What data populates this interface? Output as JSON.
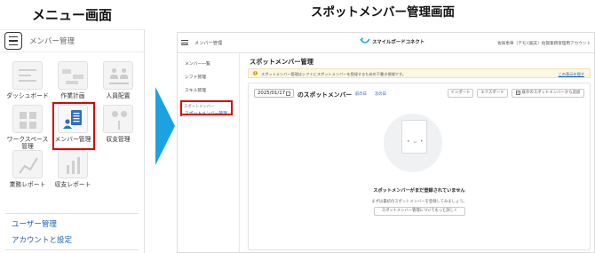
{
  "captions": {
    "left": "メニュー画面",
    "right": "スポットメンバー管理画面"
  },
  "menu": {
    "header_title": "メンバー管理",
    "tiles": [
      {
        "label": "ダッシュボード",
        "icon": "dashboard-icon"
      },
      {
        "label": "作業計画",
        "icon": "work-plan-icon"
      },
      {
        "label": "人員配置",
        "icon": "staff-placement-icon"
      },
      {
        "label": "ワークスペース管理",
        "icon": "workspace-icon"
      },
      {
        "label": "メンバー管理",
        "icon": "member-management-icon"
      },
      {
        "label": "収支管理",
        "icon": "income-expense-icon"
      },
      {
        "label": "業務レポート",
        "icon": "business-report-icon"
      },
      {
        "label": "収支レポート",
        "icon": "income-report-icon"
      }
    ],
    "links": [
      {
        "label": "ユーザー管理"
      },
      {
        "label": "アカウントと設定"
      }
    ],
    "highlight_color": "#e00000",
    "link_color": "#1a5fb4"
  },
  "app": {
    "header_title": "メンバー管理",
    "logo_text": "スマイルボードコネクト",
    "user": "佐知恵華（デモ）",
    "org": "（脇支）佐賀業務管理用アカウント",
    "sidebar": {
      "items": [
        {
          "label": "メンバー一覧"
        },
        {
          "label": "シフト管理"
        },
        {
          "label": "スキル管理"
        }
      ],
      "section": "スポットメンバー",
      "active": "スポットメンバー管理"
    },
    "page_title": "スポットメンバー管理",
    "notice": {
      "text": "スポットメンバー管理はシフトにスポットメンバーを登録するための下書き領域です。",
      "link": "この表示を隠す"
    },
    "date": "2025/01/17",
    "spot_label": "のスポットメンバー",
    "prev_day": "前の日",
    "next_day": "次の日",
    "buttons": {
      "import": "インポート",
      "export": "エクスポート",
      "add_past": "既存のスポットメンバーから追加"
    },
    "empty": {
      "title": "スポットメンバーがまだ登録されていません",
      "desc": "まずは最初のスポットメンバーを登録してみましょう。",
      "button": "スポットメンバー管理についてもっと詳しく"
    },
    "accent_color": "#2a74d4"
  }
}
